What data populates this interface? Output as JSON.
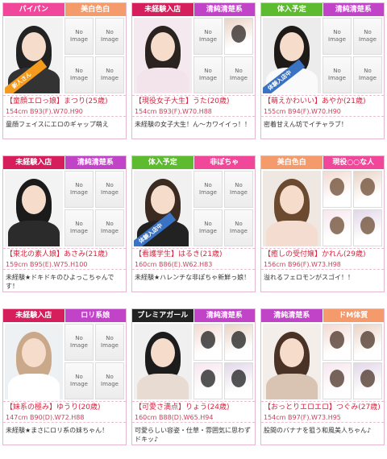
{
  "colors": {
    "pink": "#f0479a",
    "green": "#5dbb2f",
    "salmon": "#f59a6a",
    "darkpink": "#d61e5c",
    "purple": "#c144c8",
    "gray": "#a6a6a6",
    "blue": "#4da8df"
  },
  "cards": [
    {
      "tag1": "パイパン",
      "tag1_color": "#f0479a",
      "tag2": "美白色白",
      "tag2_color": "#f59a6a",
      "ribbon": "新人さん",
      "ribbon_color": "#f49a1d",
      "thumbs": [
        "No Image",
        "No Image",
        "No Image",
        "No Image"
      ],
      "name": "【童顔エロっ娘】まつり(25歳)",
      "size": "154cm B93(F).W70.H90",
      "desc": "童顔フェイスにエロのギャップ萌え"
    },
    {
      "tag1": "未経験入店",
      "tag1_color": "#d61e5c",
      "tag2": "清純清楚系",
      "tag2_color": "#c144c8",
      "ribbon": "",
      "thumbs": [
        "No Image",
        "",
        "No Image",
        "No Image"
      ],
      "name": "【現役女子大生】うた(20歳)",
      "size": "154cm B93(F).W70.H88",
      "desc": "未経験の女子大生！ん〜カワイイっ！！"
    },
    {
      "tag1": "体入予定",
      "tag1_color": "#5dbb2f",
      "tag2": "清純清楚系",
      "tag2_color": "#c144c8",
      "ribbon": "体験入店中",
      "ribbon_color": "#3a73c4",
      "thumbs": [
        "No Image",
        "No Image",
        "No Image",
        "No Image"
      ],
      "name": "【萌えかわいい】あやか(21歳)",
      "size": "155cm B94(F).W70.H90",
      "desc": "密着甘えん坊でイチャラブ！"
    },
    {
      "tag1": "未経験入店",
      "tag1_color": "#d61e5c",
      "tag2": "清純清楚系",
      "tag2_color": "#c144c8",
      "ribbon": "",
      "thumbs": [
        "No Image",
        "No Image",
        "No Image",
        "No Image"
      ],
      "name": "【東北の素人娘】あさみ(21歳)",
      "size": "159cm B95(E).W75.H100",
      "desc": "未経験★ドキドキのひよっこちゃんです！"
    },
    {
      "tag1": "体入予定",
      "tag1_color": "#5dbb2f",
      "tag2": "非ぽちゃ",
      "tag2_color": "#f0479a",
      "ribbon": "体験入店中",
      "ribbon_color": "#3a73c4",
      "thumbs": [
        "No Image",
        "No Image",
        "No Image",
        "No Image"
      ],
      "name": "【看護学生】はるき(21歳)",
      "size": "160cm B86(E).W62.H83",
      "desc": "未経験★ハレンチな非ぽちゃ新鮮っ娘！"
    },
    {
      "tag1": "美白色白",
      "tag1_color": "#f59a6a",
      "tag2": "現役○○な人",
      "tag2_color": "#f0479a",
      "ribbon": "",
      "thumbs": [
        "",
        "",
        "",
        ""
      ],
      "name": "【癒しの受付嬢】かれん(29歳)",
      "size": "156cm B96(F).W73.H98",
      "desc": "溢れるフェロモンがスゴイ！！"
    },
    {
      "tag1": "未経験入店",
      "tag1_color": "#d61e5c",
      "tag2": "ロリ系娘",
      "tag2_color": "#c144c8",
      "ribbon": "",
      "thumbs": [
        "No Image",
        "No Image",
        "No Image",
        "No Image"
      ],
      "name": "【妹系の極み】ゆうり(20歳)",
      "size": "147cm B90(D).W72.H88",
      "desc": "未経験★まさにロリ系の妹ちゃん！"
    },
    {
      "tag1": "プレミアガール",
      "tag1_color": "#222222",
      "tag2": "清純清楚系",
      "tag2_color": "#c144c8",
      "ribbon": "",
      "thumbs": [
        "",
        "",
        "",
        ""
      ],
      "name": "【可愛さ満点】りょう(24歳)",
      "size": "160cm B88(D).W65.H94",
      "desc": "可愛らしい容姿・仕草・雰囲気に思わずドキッ♪"
    },
    {
      "tag1": "清純清楚系",
      "tag1_color": "#c144c8",
      "tag2": "ドM体質",
      "tag2_color": "#f59a6a",
      "ribbon": "",
      "thumbs": [
        "",
        "",
        "",
        ""
      ],
      "name": "【おっとりエロエロ】つぐみ(27歳)",
      "size": "154cm B97(F).W73.H95",
      "desc": "股間のバナナを狙う和風美人ちゃん♪"
    }
  ]
}
